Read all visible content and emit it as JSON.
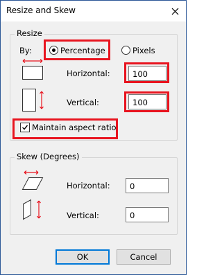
{
  "dialog": {
    "title": "Resize and Skew"
  },
  "resize": {
    "group_label": "Resize",
    "by_label": "By:",
    "options": {
      "percentage": "Percentage",
      "pixels": "Pixels"
    },
    "selected": "percentage",
    "horizontal_label": "Horizontal:",
    "horizontal_value": "100",
    "vertical_label": "Vertical:",
    "vertical_value": "100",
    "maintain_aspect_label": "Maintain aspect ratio",
    "maintain_aspect_checked": true
  },
  "skew": {
    "group_label": "Skew (Degrees)",
    "horizontal_label": "Horizontal:",
    "horizontal_value": "0",
    "vertical_label": "Vertical:",
    "vertical_value": "0"
  },
  "buttons": {
    "ok": "OK",
    "cancel": "Cancel"
  },
  "colors": {
    "highlight": "#e8141f",
    "arrow": "#e8141f",
    "accent": "#0078d7"
  },
  "icons": [
    "close-icon",
    "horizontal-resize-icon",
    "vertical-resize-icon",
    "horizontal-skew-icon",
    "vertical-skew-icon",
    "checkmark-icon"
  ]
}
